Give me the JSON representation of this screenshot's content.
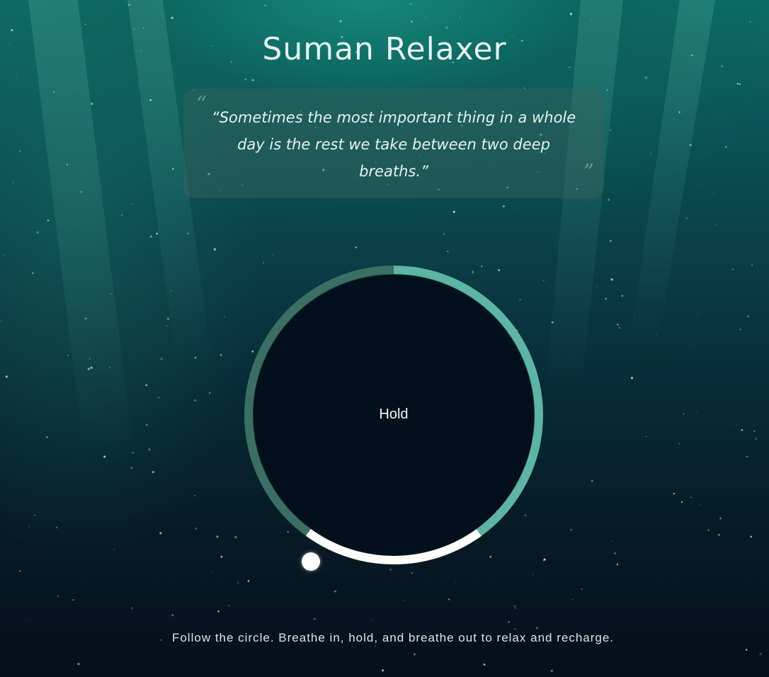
{
  "app": {
    "title": "Suman Relaxer"
  },
  "quote": {
    "open_mark": "“",
    "close_mark": "”",
    "text": "“Sometimes the most important thing in a whole day is the rest we take between two deep breaths.”"
  },
  "breathing": {
    "phase": "Hold",
    "segments": [
      {
        "name": "Breathe in",
        "fraction": 0.4,
        "color": "#5db5a3"
      },
      {
        "name": "Hold",
        "fraction": 0.2,
        "color": "#ffffff"
      },
      {
        "name": "Breathe out",
        "fraction": 0.4,
        "color": "#3a6f62"
      }
    ],
    "inner_color": "#020f1c"
  },
  "footer": {
    "text": "Follow the circle. Breathe in, hold, and breathe out to relax and recharge."
  },
  "colors": {
    "accent": "#5db5a3",
    "text": "#e8f4f1"
  }
}
